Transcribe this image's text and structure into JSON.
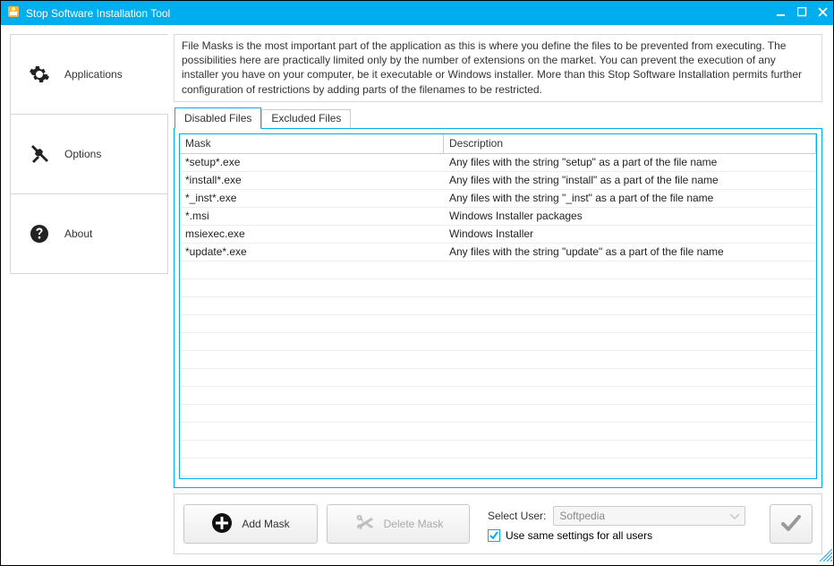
{
  "window": {
    "title": "Stop Software Installation Tool"
  },
  "sidebar": {
    "items": [
      {
        "label": "Applications"
      },
      {
        "label": "Options"
      },
      {
        "label": "About"
      }
    ]
  },
  "description": "File Masks is the most important part of the application as this is where you define the files to be prevented from executing. The possibilities here are practically limited only by the number of extensions on the market. You can prevent the execution of any installer you have on your computer, be it executable or Windows installer. More than this Stop Software Installation permits further configuration of restrictions by adding parts of the filenames to be restricted.",
  "tabs": {
    "disabled": "Disabled Files",
    "excluded": "Excluded Files"
  },
  "table": {
    "headers": {
      "mask": "Mask",
      "description": "Description"
    },
    "rows": [
      {
        "mask": "*setup*.exe",
        "desc": "Any files with the string \"setup\" as a part of the file name"
      },
      {
        "mask": "*install*.exe",
        "desc": "Any files with the string \"install\" as a part of the file name"
      },
      {
        "mask": "*_inst*.exe",
        "desc": "Any files with the string \"_inst\" as a part of the file name"
      },
      {
        "mask": "*.msi",
        "desc": "Windows Installer packages"
      },
      {
        "mask": "msiexec.exe",
        "desc": "Windows Installer"
      },
      {
        "mask": "*update*.exe",
        "desc": "Any files with the string \"update\" as a part of the file name"
      }
    ]
  },
  "bottom": {
    "add": "Add Mask",
    "delete": "Delete Mask",
    "select_user_label": "Select User:",
    "selected_user": "Softpedia",
    "checkbox_label": "Use same settings for all users"
  }
}
